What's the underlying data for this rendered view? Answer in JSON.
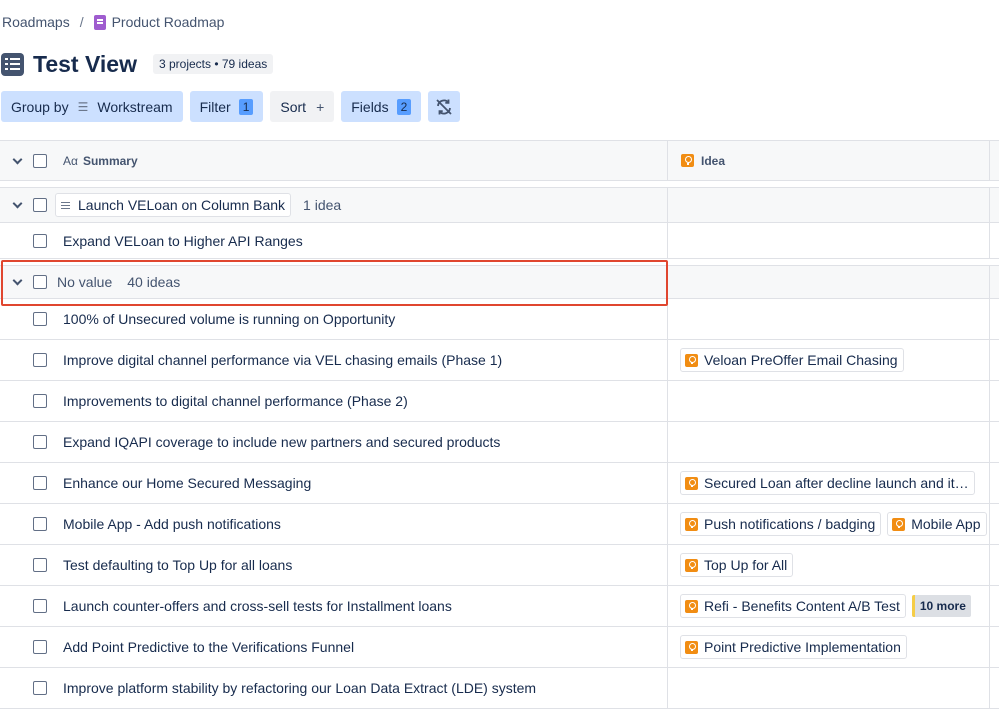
{
  "breadcrumb": {
    "root": "Roadmaps",
    "separator": "/",
    "current": "Product Roadmap"
  },
  "header": {
    "title": "Test View",
    "counts": "3 projects • 79 ideas"
  },
  "toolbar": {
    "group_by_label": "Group by",
    "group_by_value": "Workstream",
    "filter_label": "Filter",
    "filter_count": "1",
    "sort_label": "Sort",
    "sort_plus": "+",
    "fields_label": "Fields",
    "fields_count": "2"
  },
  "columns": {
    "summary_prefix": "Aα",
    "summary": "Summary",
    "idea": "Idea"
  },
  "groups": [
    {
      "name": "Launch VELoan on Column Bank",
      "count": "1 idea"
    },
    {
      "name": "No value",
      "count": "40 ideas"
    }
  ],
  "rows_group1": [
    {
      "summary": "Expand VELoan to Higher API Ranges",
      "ideas": []
    }
  ],
  "rows_group2": [
    {
      "summary": "100% of Unsecured volume is running on Opportunity",
      "ideas": []
    },
    {
      "summary": "Improve digital channel performance via VEL chasing emails (Phase 1)",
      "ideas": [
        "Veloan PreOffer Email Chasing"
      ]
    },
    {
      "summary": "Improvements to digital channel performance (Phase 2)",
      "ideas": []
    },
    {
      "summary": "Expand IQAPI coverage to include new partners and secured products",
      "ideas": []
    },
    {
      "summary": "Enhance our Home Secured Messaging",
      "ideas": [
        "Secured Loan after decline launch and it…"
      ]
    },
    {
      "summary": "Mobile App - Add push notifications",
      "ideas": [
        "Push notifications / badging",
        "Mobile App"
      ]
    },
    {
      "summary": "Test defaulting to Top Up for all loans",
      "ideas": [
        "Top Up for All"
      ]
    },
    {
      "summary": "Launch counter-offers and cross-sell tests for Installment loans",
      "ideas": [
        "Refi - Benefits Content A/B Test"
      ],
      "more": "10 more"
    },
    {
      "summary": "Add Point Predictive to the Verifications Funnel",
      "ideas": [
        "Point Predictive Implementation"
      ]
    },
    {
      "summary": "Improve platform stability by refactoring our Loan Data Extract (LDE) system",
      "ideas": []
    }
  ],
  "colors": {
    "accent": "#cce0ff",
    "badge": "#579dff",
    "idea_icon": "#f18d13",
    "highlight": "#e0462f",
    "roadmap_icon": "#9f5ccf"
  }
}
